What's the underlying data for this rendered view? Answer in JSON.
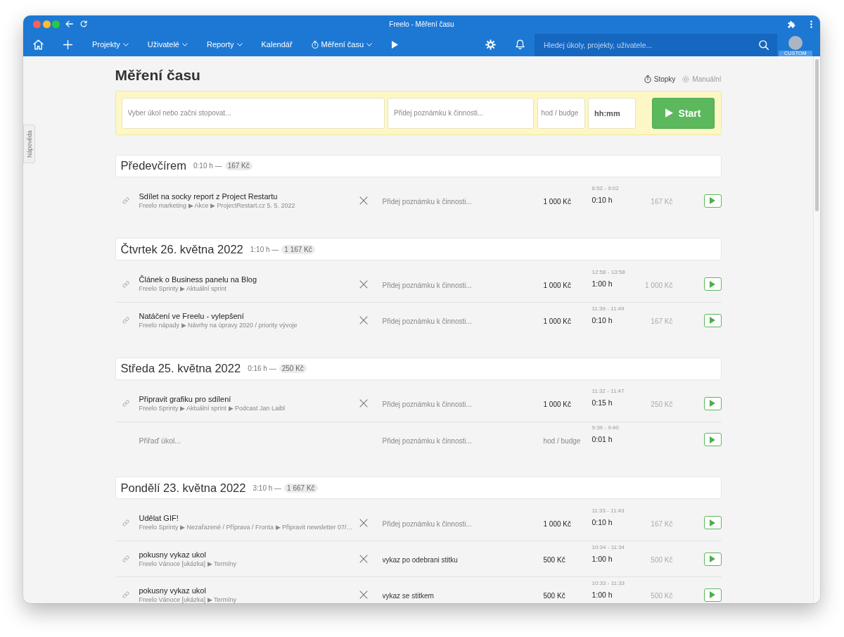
{
  "window": {
    "title": "Freelo - Měření času"
  },
  "navbar": {
    "items": [
      {
        "kind": "plain",
        "label": "Projekty",
        "dropdown": true
      },
      {
        "kind": "plain",
        "label": "Uživatelé",
        "dropdown": true
      },
      {
        "kind": "plain",
        "label": "Reporty",
        "dropdown": true
      },
      {
        "kind": "plain",
        "label": "Kalendář",
        "dropdown": false
      },
      {
        "kind": "timer",
        "label": "Měření času",
        "dropdown": true
      }
    ],
    "search": {
      "placeholder": "Hledej úkoly, projekty, uživatele..."
    },
    "avatar": {
      "badge": "CUSTOM"
    }
  },
  "help_tab": {
    "label": "Nápověda"
  },
  "page": {
    "title": "Měření času",
    "modes": [
      {
        "kind": "stopwatch",
        "label": "Stopky",
        "selected": true
      },
      {
        "kind": "manual",
        "label": "Manuální",
        "selected": false
      }
    ]
  },
  "tracker": {
    "task_field": {
      "placeholder": "Vyber úkol nebo začni stopovat..."
    },
    "note_field": {
      "placeholder": "Přidej poznámku k činnosti..."
    },
    "rate_field": {
      "placeholder": "hod / budge"
    },
    "time_field": {
      "placeholder": "hh:mm"
    },
    "start_button": {
      "label": "Start"
    }
  },
  "days": [
    {
      "title": "Předevčírem",
      "duration": "0:10 h —",
      "total": "167 Kč",
      "entries": [
        {
          "kind": "task",
          "title": "Sdílet na socky report z Project Restartu",
          "path": "Freelo marketing ▶ Akce ▶ ProjectRestart.cz 5. 5. 2022",
          "note": {
            "placeholder": "Přidej poznámku k činnosti..."
          },
          "rate": {
            "value": "1 000 Kč"
          },
          "range": "8:52 - 9:02",
          "duration": "0:10 h",
          "cost": "167 Kč"
        }
      ]
    },
    {
      "title": "Čtvrtek 26. května 2022",
      "duration": "1:10 h —",
      "total": "1 167 Kč",
      "entries": [
        {
          "kind": "task",
          "title": "Článek o Business panelu na Blog",
          "path": "Freelo Sprinty ▶ Aktuální sprint",
          "note": {
            "placeholder": "Přidej poznámku k činnosti..."
          },
          "rate": {
            "value": "1 000 Kč"
          },
          "range": "12:58 - 13:58",
          "duration": "1:00 h",
          "cost": "1 000 Kč"
        },
        {
          "kind": "task",
          "title": "Natáčení ve Freelu - vylepšení",
          "path": "Freelo nápady ▶ Návrhy na úpravy 2020 / priority vývoje",
          "note": {
            "placeholder": "Přidej poznámku k činnosti..."
          },
          "rate": {
            "value": "1 000 Kč"
          },
          "range": "11:39 - 11:49",
          "duration": "0:10 h",
          "cost": "167 Kč"
        }
      ]
    },
    {
      "title": "Středa 25. května 2022",
      "duration": "0:16 h —",
      "total": "250 Kč",
      "entries": [
        {
          "kind": "task",
          "title": "Připravit grafiku pro sdílení",
          "path": "Freelo Sprinty ▶ Aktuální sprint ▶ Podcast Jan Laibl",
          "note": {
            "placeholder": "Přidej poznámku k činnosti..."
          },
          "rate": {
            "value": "1 000 Kč"
          },
          "range": "11:32 - 11:47",
          "duration": "0:15 h",
          "cost": "250 Kč"
        },
        {
          "kind": "unassigned",
          "task": {
            "placeholder": "Přiřaď úkol..."
          },
          "note": {
            "placeholder": "Přidej poznámku k činnosti..."
          },
          "rate": {
            "placeholder": "hod / budge"
          },
          "range": "9:39 - 9:40",
          "duration": "0:01 h"
        }
      ]
    },
    {
      "title": "Pondělí 23. května 2022",
      "duration": "3:10 h —",
      "total": "1 667 Kč",
      "entries": [
        {
          "kind": "task",
          "title": "Udělat GIF!",
          "path": "Freelo Sprinty ▶ Nezařazené / Příprava / Fronta ▶ Připravit newsletter 07/…",
          "note": {
            "placeholder": "Přidej poznámku k činnosti..."
          },
          "rate": {
            "value": "1 000 Kč"
          },
          "range": "11:33 - 11:43",
          "duration": "0:10 h",
          "cost": "167 Kč"
        },
        {
          "kind": "task",
          "title": "pokusny vykaz ukol",
          "path": "Freelo Vánoce [ukázka] ▶ Termíny",
          "note": {
            "value": "vykaz po odebrani stitku"
          },
          "rate": {
            "value": "500 Kč"
          },
          "range": "10:34 - 11:34",
          "duration": "1:00 h",
          "cost": "500 Kč"
        },
        {
          "kind": "task",
          "title": "pokusny vykaz ukol",
          "path": "Freelo Vánoce [ukázka] ▶ Termíny",
          "note": {
            "value": "vykaz se stitkem"
          },
          "rate": {
            "value": "500 Kč"
          },
          "range": "10:33 - 11:33",
          "duration": "1:00 h",
          "cost": "500 Kč"
        }
      ]
    }
  ]
}
